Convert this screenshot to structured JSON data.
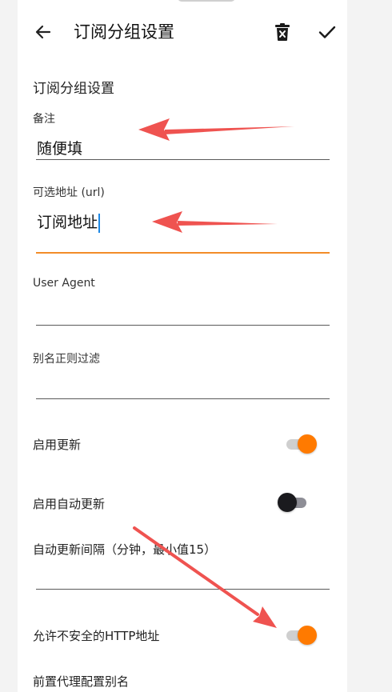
{
  "appbar": {
    "title": "订阅分组设置",
    "back_icon": "arrow-left-icon",
    "delete_icon": "delete-icon",
    "confirm_icon": "check-icon"
  },
  "form": {
    "section_title": "订阅分组设置",
    "remarks": {
      "label": "备注",
      "value": "随便填"
    },
    "url": {
      "label": "可选地址 (url)",
      "value": "订阅地址"
    },
    "user_agent": {
      "label": "User Agent",
      "value": ""
    },
    "alias_filter": {
      "label": "别名正则过滤",
      "value": ""
    },
    "enable_update": {
      "label": "启用更新",
      "on": true
    },
    "enable_auto_update": {
      "label": "启用自动更新",
      "on": false
    },
    "auto_update_interval": {
      "label": "自动更新间隔（分钟，最小值15）",
      "value": ""
    },
    "allow_insecure_http": {
      "label": "允许不安全的HTTP地址",
      "on": true
    },
    "prev_proxy_alias": {
      "label": "前置代理配置别名"
    }
  },
  "colors": {
    "accent": "#ff7a00",
    "active_underline": "#f28c28",
    "annotation_arrow": "#ef5350",
    "caret": "#1e88e5"
  }
}
